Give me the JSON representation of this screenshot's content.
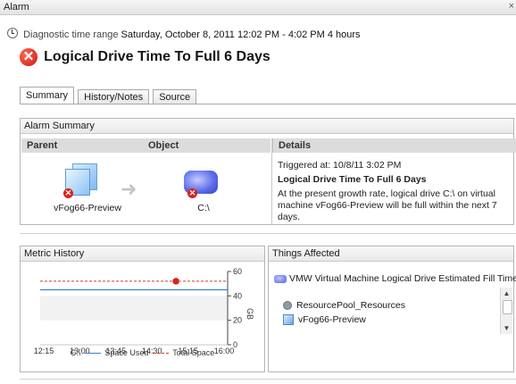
{
  "window": {
    "title": "Alarm",
    "close_glyph": "×"
  },
  "diagnostic": {
    "label": "Diagnostic time range",
    "value": "Saturday, October 8, 2011  12:02 PM - 4:02 PM  4 hours"
  },
  "alarm": {
    "title": "Logical Drive Time To Full 6 Days",
    "severity_icon": "error-icon"
  },
  "tabs": [
    {
      "label": "Summary",
      "active": true
    },
    {
      "label": "History/Notes",
      "active": false
    },
    {
      "label": "Source",
      "active": false
    }
  ],
  "alarm_summary": {
    "title": "Alarm Summary",
    "columns": {
      "parent": "Parent",
      "object": "Object",
      "details": "Details"
    },
    "parent_name": "vFog66-Preview",
    "object_name": "C:\\",
    "details": {
      "triggered": "Triggered at: 10/8/11 3:02 PM",
      "title": "Logical Drive Time To Full 6 Days",
      "text": "At the present growth rate, logical drive C:\\ on virtual machine vFog66-Preview will be full within the next 7 days."
    }
  },
  "metric_history": {
    "title": "Metric History",
    "legend_c": "C:\\",
    "legend_used": "Space Used",
    "legend_total": "Total Space"
  },
  "things_affected": {
    "title": "Things Affected",
    "headline": "VMW Virtual Machine Logical Drive Estimated Fill Time",
    "items": [
      "ResourcePool_Resources",
      "vFog66-Preview"
    ]
  },
  "colors": {
    "space_used": "#3a7fd5",
    "total_space": "#d23a2a",
    "error": "#d8231a"
  },
  "chart_data": {
    "type": "line",
    "x": [
      "12:15",
      "13:00",
      "13:45",
      "14:30",
      "15:15",
      "16:00"
    ],
    "ylabel": "GB",
    "ylim": [
      0,
      60
    ],
    "yticks": [
      0,
      20,
      40,
      60
    ],
    "series": [
      {
        "name": "Space Used",
        "values": [
          45,
          45,
          45,
          45,
          45,
          45
        ]
      },
      {
        "name": "Total Space",
        "values": [
          52,
          52,
          52,
          52,
          52,
          52
        ]
      }
    ],
    "alarm_marker_x": "15:00"
  }
}
